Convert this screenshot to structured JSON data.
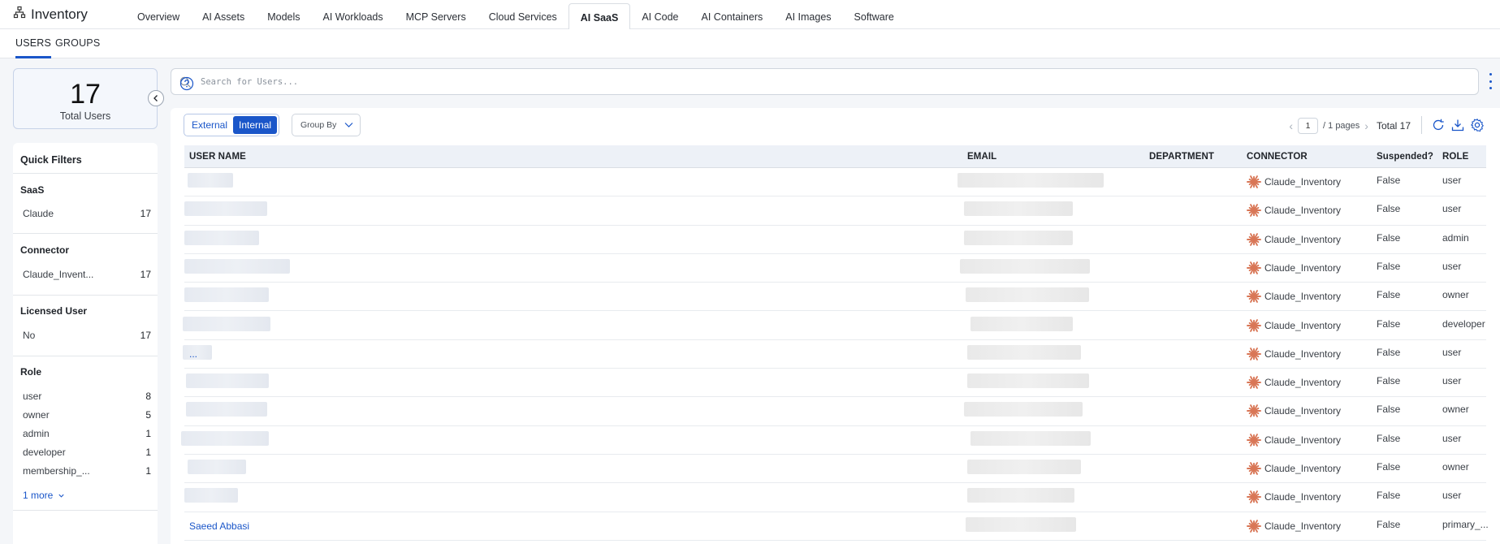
{
  "app": {
    "title": "Inventory",
    "icon": "sitemap-icon"
  },
  "main_tabs": [
    {
      "label": "Overview"
    },
    {
      "label": "AI Assets"
    },
    {
      "label": "Models"
    },
    {
      "label": "AI Workloads"
    },
    {
      "label": "MCP Servers"
    },
    {
      "label": "Cloud Services"
    },
    {
      "label": "AI SaaS"
    },
    {
      "label": "AI Code"
    },
    {
      "label": "AI Containers"
    },
    {
      "label": "AI Images"
    },
    {
      "label": "Software"
    }
  ],
  "active_main_tab": "AI SaaS",
  "sub_tabs": [
    {
      "label": "USERS"
    },
    {
      "label": "GROUPS"
    }
  ],
  "summary": {
    "count": "17",
    "label": "Total Users"
  },
  "filters": {
    "title": "Quick Filters",
    "sections": [
      {
        "title": "SaaS",
        "items": [
          {
            "label": "Claude",
            "count": "17"
          }
        ]
      },
      {
        "title": "Connector",
        "items": [
          {
            "label": "Claude_Invent...",
            "count": "17"
          }
        ]
      },
      {
        "title": "Licensed User",
        "items": [
          {
            "label": "No",
            "count": "17"
          }
        ]
      },
      {
        "title": "Role",
        "items": [
          {
            "label": "user",
            "count": "8"
          },
          {
            "label": "owner",
            "count": "5"
          },
          {
            "label": "admin",
            "count": "1"
          },
          {
            "label": "developer",
            "count": "1"
          },
          {
            "label": "membership_...",
            "count": "1"
          }
        ]
      }
    ],
    "more_label": "1 more"
  },
  "search": {
    "placeholder": "Search for Users..."
  },
  "toolbar": {
    "external_label": "External",
    "internal_label": "Internal",
    "group_by_label": "Group By",
    "page_value": "1",
    "pages_label": "/  1 pages",
    "total_label": "Total 17"
  },
  "table": {
    "columns": [
      "USER NAME",
      "EMAIL",
      "DEPARTMENT",
      "CONNECTOR",
      "Suspended?",
      "ROLE"
    ],
    "rows": [
      {
        "name": "",
        "connector": "Claude_Inventory",
        "suspended": "False",
        "role": "user"
      },
      {
        "name": "",
        "connector": "Claude_Inventory",
        "suspended": "False",
        "role": "user"
      },
      {
        "name": "",
        "connector": "Claude_Inventory",
        "suspended": "False",
        "role": "admin"
      },
      {
        "name": "",
        "connector": "Claude_Inventory",
        "suspended": "False",
        "role": "user"
      },
      {
        "name": "",
        "connector": "Claude_Inventory",
        "suspended": "False",
        "role": "owner"
      },
      {
        "name": "",
        "connector": "Claude_Inventory",
        "suspended": "False",
        "role": "developer"
      },
      {
        "name": "...",
        "connector": "Claude_Inventory",
        "suspended": "False",
        "role": "user"
      },
      {
        "name": "",
        "connector": "Claude_Inventory",
        "suspended": "False",
        "role": "user"
      },
      {
        "name": "",
        "connector": "Claude_Inventory",
        "suspended": "False",
        "role": "owner"
      },
      {
        "name": "",
        "connector": "Claude_Inventory",
        "suspended": "False",
        "role": "user"
      },
      {
        "name": "",
        "connector": "Claude_Inventory",
        "suspended": "False",
        "role": "owner"
      },
      {
        "name": "",
        "connector": "Claude_Inventory",
        "suspended": "False",
        "role": "user"
      },
      {
        "name": "Saeed Abbasi",
        "connector": "Claude_Inventory",
        "suspended": "False",
        "role": "primary_..."
      }
    ]
  },
  "colors": {
    "accent": "#1a56c9",
    "connector_icon": "#d97757"
  },
  "icons": [
    "sitemap-icon",
    "chevron-left-icon",
    "search-icon",
    "help-icon",
    "kebab-icon",
    "chevron-down-icon",
    "refresh-icon",
    "download-icon",
    "gear-icon",
    "claude-icon"
  ]
}
